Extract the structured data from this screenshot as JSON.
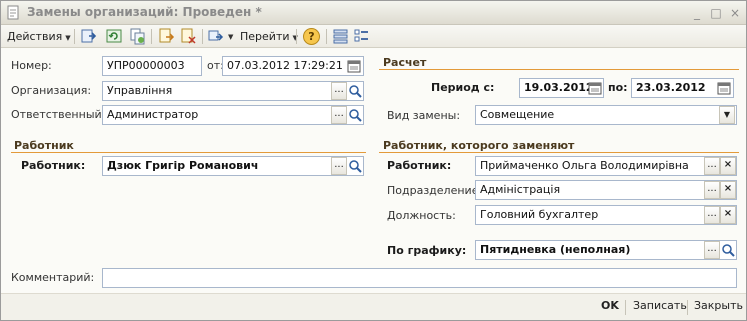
{
  "window": {
    "title": "Замены организаций: Проведен *",
    "controls": [
      "_",
      "□",
      "×"
    ]
  },
  "toolbar": {
    "actions_label": "Действия",
    "goto_label": "Перейти",
    "help_label": "?"
  },
  "form": {
    "number_label": "Номер:",
    "number_value": "УПР00000003",
    "date_label": "от:",
    "date_value": "07.03.2012 17:29:21",
    "org_label": "Организация:",
    "org_value": "Управління",
    "responsible_label": "Ответственный:",
    "responsible_value": "Администратор",
    "comment_label": "Комментарий:",
    "comment_value": ""
  },
  "worker_section": {
    "title": "Работник",
    "worker_label": "Работник:",
    "worker_value": "Дзюк Григір Романович"
  },
  "calc_section": {
    "title": "Расчет",
    "period_label": "Период с:",
    "period_from": "19.03.2012",
    "period_to_label": "по:",
    "period_to": "23.03.2012",
    "replace_type_label": "Вид замены:",
    "replace_type_value": "Совмещение"
  },
  "replaced_section": {
    "title": "Работник, которого заменяют",
    "worker_label": "Работник:",
    "worker_value": "Приймаченко Ольга Володимирівна",
    "dept_label": "Подразделение:",
    "dept_value": "Адміністрація",
    "position_label": "Должность:",
    "position_value": "Головний бухгалтер",
    "schedule_label": "По графику:",
    "schedule_value": "Пятидневка (неполная)"
  },
  "buttons": {
    "ok": "OK",
    "save": "Записать",
    "close": "Закрыть",
    "select": "...",
    "clear": "×"
  },
  "colors": {
    "section_line": "#e39a3a",
    "field_border": "#a8b7cc"
  }
}
